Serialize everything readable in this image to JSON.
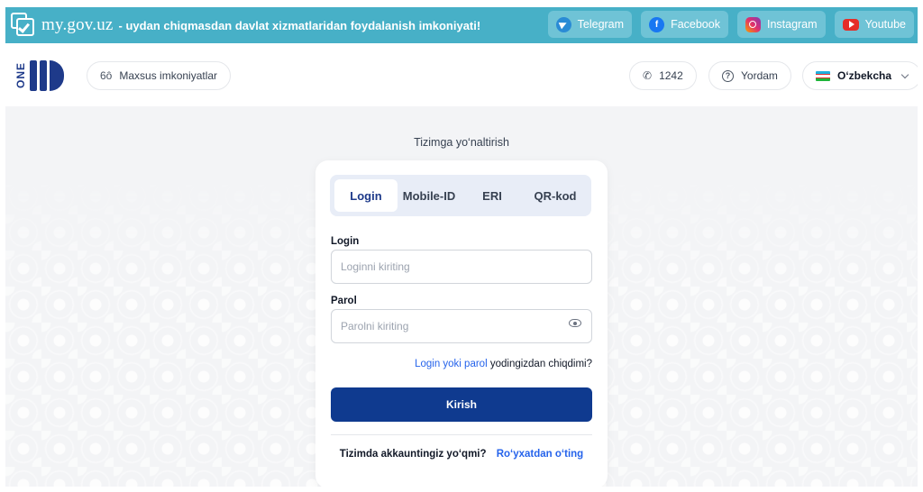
{
  "banner": {
    "site_name": "my.gov.uz",
    "tagline": "- uydan chiqmasdan davlat xizmatlaridan foydalanish imkoniyati!",
    "socials": [
      {
        "label": "Telegram",
        "icon": "telegram-icon"
      },
      {
        "label": "Facebook",
        "icon": "facebook-icon"
      },
      {
        "label": "Instagram",
        "icon": "instagram-icon"
      },
      {
        "label": "Youtube",
        "icon": "youtube-icon"
      }
    ],
    "color": "#47b0c7"
  },
  "header": {
    "logo_text": "ONE",
    "accessibility_label": "Maxsus imkoniyatlar",
    "phone_label": "1242",
    "help_label": "Yordam",
    "language_label": "O‘zbekcha"
  },
  "login": {
    "section_title": "Tizimga yo‘naltirish",
    "tabs": [
      "Login",
      "Mobile-ID",
      "ERI",
      "QR-kod"
    ],
    "active_tab": "Login",
    "login_label": "Login",
    "login_placeholder": "Loginni kiriting",
    "password_label": "Parol",
    "password_placeholder": "Parolni kiriting",
    "forgot_link": "Login yoki parol",
    "forgot_rest": "yodingizdan chiqdimi?",
    "submit_label": "Kirish",
    "signup_question": "Tizimda akkauntingiz yo‘qmi?",
    "signup_link": "Ro‘yxatdan o‘ting",
    "primary_color": "#0f3a8f",
    "link_color": "#2563eb"
  }
}
